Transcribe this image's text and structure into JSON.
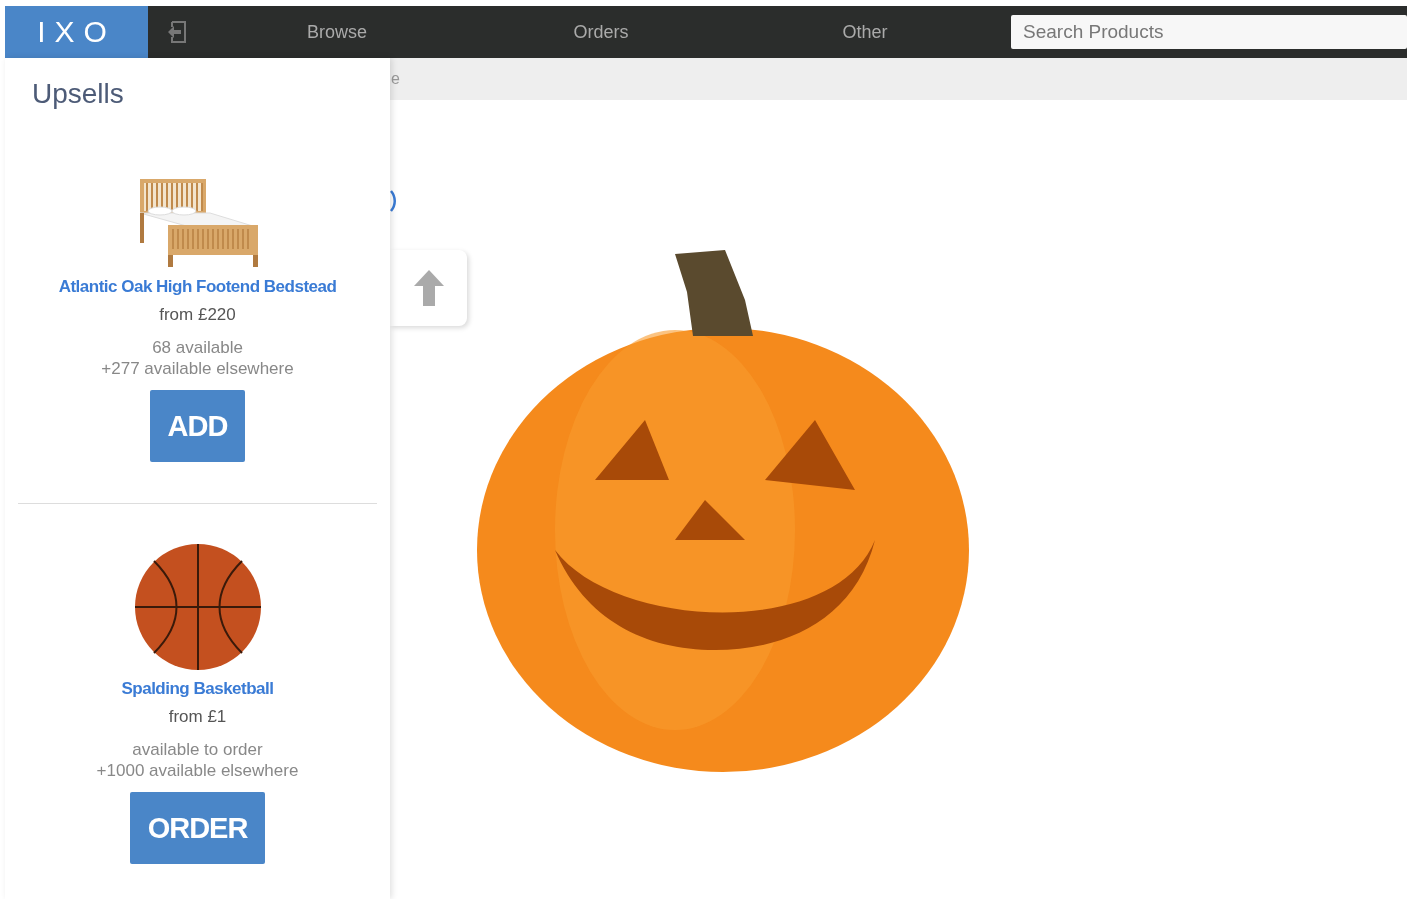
{
  "logo": "IXO",
  "nav": [
    {
      "label": "Browse"
    },
    {
      "label": "Orders"
    },
    {
      "label": "Other"
    }
  ],
  "search": {
    "placeholder": "Search Products"
  },
  "breadcrumb": "e",
  "upsells": {
    "title": "Upsells",
    "items": [
      {
        "kind": "bed",
        "name": "Atlantic Oak High Footend Bedstead",
        "price": "from £220",
        "availability": "68 available",
        "elsewhere": "+277 available elsewhere",
        "action": "ADD"
      },
      {
        "kind": "ball",
        "name": "Spalding Basketball",
        "price": "from £1",
        "availability": "available to order",
        "elsewhere": "+1000 available elsewhere",
        "action": "ORDER"
      }
    ]
  }
}
